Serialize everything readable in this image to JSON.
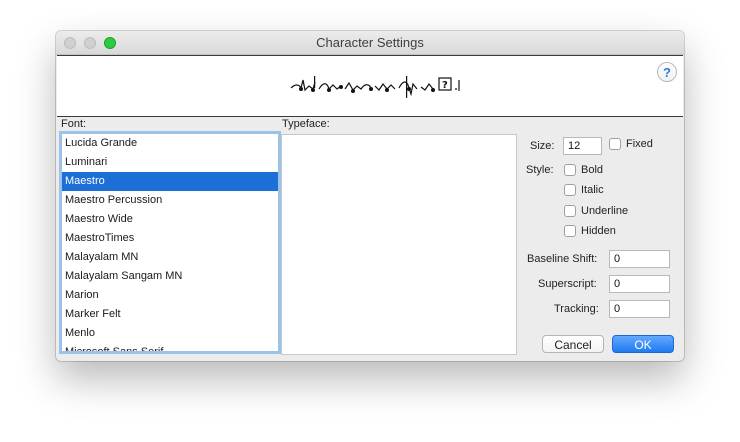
{
  "window": {
    "title": "Character Settings"
  },
  "preview": {
    "icon": "music-notation-preview-icon",
    "help_label": "?"
  },
  "font_section": {
    "label": "Font:",
    "items": [
      {
        "label": "Lucida Grande",
        "selected": false
      },
      {
        "label": "Luminari",
        "selected": false
      },
      {
        "label": "Maestro",
        "selected": true
      },
      {
        "label": "Maestro Percussion",
        "selected": false
      },
      {
        "label": "Maestro Wide",
        "selected": false
      },
      {
        "label": "MaestroTimes",
        "selected": false
      },
      {
        "label": "Malayalam MN",
        "selected": false
      },
      {
        "label": "Malayalam Sangam MN",
        "selected": false
      },
      {
        "label": "Marion",
        "selected": false
      },
      {
        "label": "Marker Felt",
        "selected": false
      },
      {
        "label": "Menlo",
        "selected": false
      },
      {
        "label": "Microsoft Sans Serif",
        "selected": false
      }
    ]
  },
  "typeface_section": {
    "label": "Typeface:"
  },
  "settings": {
    "size_label": "Size:",
    "size_value": "12",
    "fixed_label": "Fixed",
    "style_label": "Style:",
    "bold_label": "Bold",
    "italic_label": "Italic",
    "underline_label": "Underline",
    "hidden_label": "Hidden",
    "baseline_shift_label": "Baseline Shift:",
    "baseline_shift_value": "0",
    "superscript_label": "Superscript:",
    "superscript_value": "0",
    "tracking_label": "Tracking:",
    "tracking_value": "0"
  },
  "buttons": {
    "cancel_label": "Cancel",
    "ok_label": "OK"
  },
  "colors": {
    "selection": "#1c6fd6",
    "ok_button": "#1f7bf1",
    "focus_ring": "#9bc2ea",
    "zoom_button": "#2ccb41"
  }
}
